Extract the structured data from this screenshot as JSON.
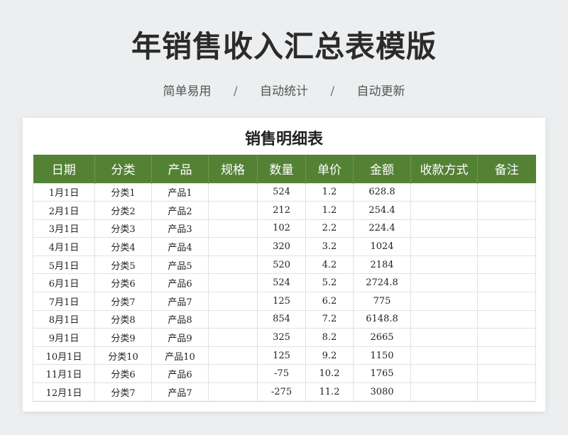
{
  "page": {
    "title": "年销售收入汇总表模版",
    "tags": [
      "简单易用",
      "自动统计",
      "自动更新"
    ],
    "separator": "/"
  },
  "sheet": {
    "title": "销售明细表",
    "headers": [
      "日期",
      "分类",
      "产品",
      "规格",
      "数量",
      "单价",
      "金额",
      "收款方式",
      "备注"
    ],
    "rows": [
      [
        "1月1日",
        "分类1",
        "产品1",
        "",
        "524",
        "1.2",
        "628.8",
        "",
        ""
      ],
      [
        "2月1日",
        "分类2",
        "产品2",
        "",
        "212",
        "1.2",
        "254.4",
        "",
        ""
      ],
      [
        "3月1日",
        "分类3",
        "产品3",
        "",
        "102",
        "2.2",
        "224.4",
        "",
        ""
      ],
      [
        "4月1日",
        "分类4",
        "产品4",
        "",
        "320",
        "3.2",
        "1024",
        "",
        ""
      ],
      [
        "5月1日",
        "分类5",
        "产品5",
        "",
        "520",
        "4.2",
        "2184",
        "",
        ""
      ],
      [
        "6月1日",
        "分类6",
        "产品6",
        "",
        "524",
        "5.2",
        "2724.8",
        "",
        ""
      ],
      [
        "7月1日",
        "分类7",
        "产品7",
        "",
        "125",
        "6.2",
        "775",
        "",
        ""
      ],
      [
        "8月1日",
        "分类8",
        "产品8",
        "",
        "854",
        "7.2",
        "6148.8",
        "",
        ""
      ],
      [
        "9月1日",
        "分类9",
        "产品9",
        "",
        "325",
        "8.2",
        "2665",
        "",
        ""
      ],
      [
        "10月1日",
        "分类10",
        "产品10",
        "",
        "125",
        "9.2",
        "1150",
        "",
        ""
      ],
      [
        "11月1日",
        "分类6",
        "产品6",
        "",
        "-75",
        "10.2",
        "1765",
        "",
        ""
      ],
      [
        "12月1日",
        "分类7",
        "产品7",
        "",
        "-275",
        "11.2",
        "3080",
        "",
        ""
      ]
    ]
  },
  "colors": {
    "header_bg": "#548235",
    "page_bg": "#eceeef"
  }
}
